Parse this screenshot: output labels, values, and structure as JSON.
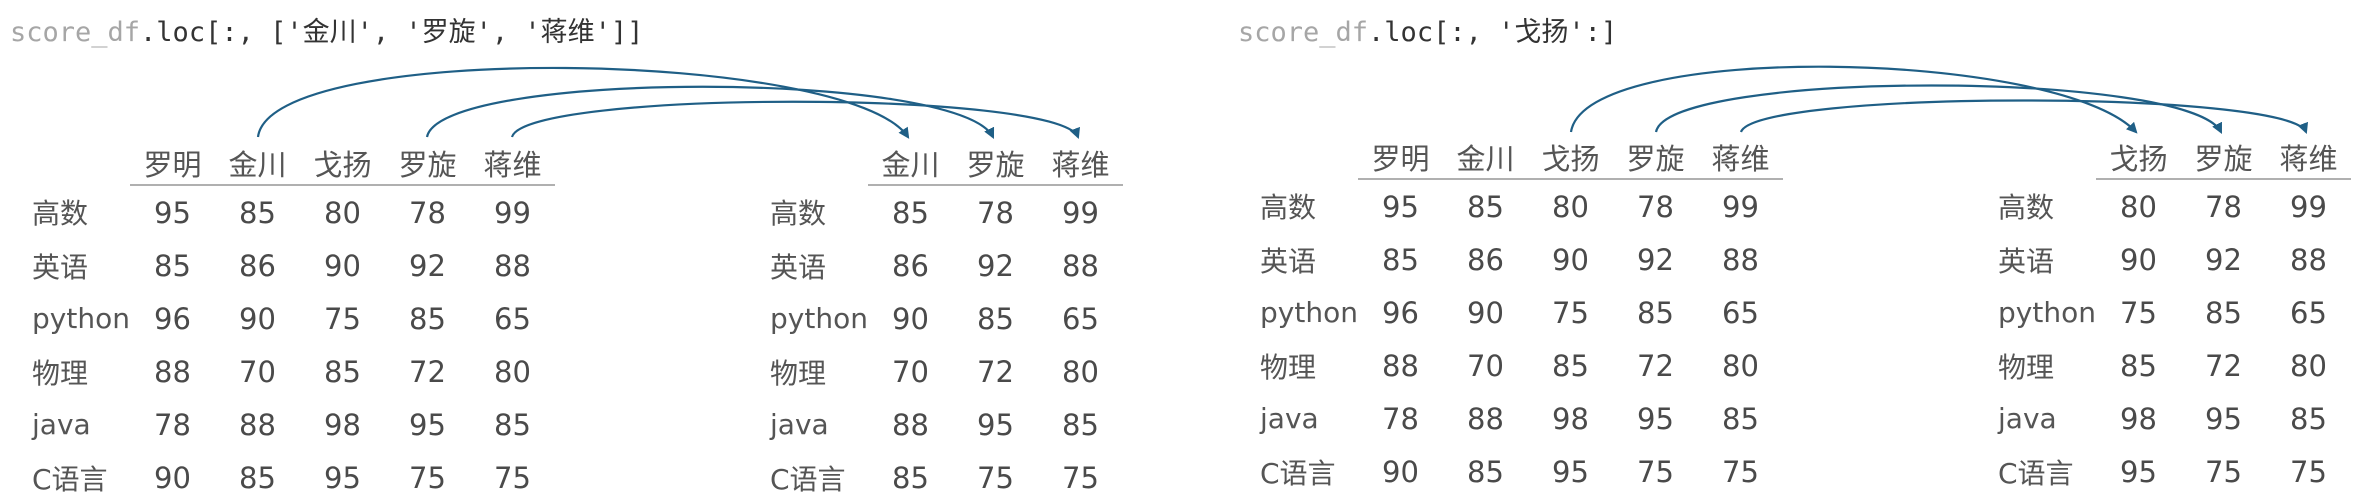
{
  "left": {
    "code": {
      "var": "score_df",
      "rest": ".loc[:, ['金川', '罗旋', '蒋维']]"
    },
    "source_table": {
      "columns": [
        "罗明",
        "金川",
        "戈扬",
        "罗旋",
        "蒋维"
      ],
      "rows": [
        {
          "label": "高数",
          "values": [
            "95",
            "85",
            "80",
            "78",
            "99"
          ]
        },
        {
          "label": "英语",
          "values": [
            "85",
            "86",
            "90",
            "92",
            "88"
          ]
        },
        {
          "label": "python",
          "values": [
            "96",
            "90",
            "75",
            "85",
            "65"
          ]
        },
        {
          "label": "物理",
          "values": [
            "88",
            "70",
            "85",
            "72",
            "80"
          ]
        },
        {
          "label": "java",
          "values": [
            "78",
            "88",
            "98",
            "95",
            "85"
          ]
        },
        {
          "label": "C语言",
          "values": [
            "90",
            "85",
            "95",
            "75",
            "75"
          ]
        }
      ]
    },
    "result_table": {
      "columns": [
        "金川",
        "罗旋",
        "蒋维"
      ],
      "rows": [
        {
          "label": "高数",
          "values": [
            "85",
            "78",
            "99"
          ]
        },
        {
          "label": "英语",
          "values": [
            "86",
            "92",
            "88"
          ]
        },
        {
          "label": "python",
          "values": [
            "90",
            "85",
            "65"
          ]
        },
        {
          "label": "物理",
          "values": [
            "70",
            "72",
            "80"
          ]
        },
        {
          "label": "java",
          "values": [
            "88",
            "95",
            "85"
          ]
        },
        {
          "label": "C语言",
          "values": [
            "85",
            "75",
            "75"
          ]
        }
      ]
    }
  },
  "right": {
    "code": {
      "var": "score_df",
      "rest": ".loc[:, '戈扬':]"
    },
    "source_table": {
      "columns": [
        "罗明",
        "金川",
        "戈扬",
        "罗旋",
        "蒋维"
      ],
      "rows": [
        {
          "label": "高数",
          "values": [
            "95",
            "85",
            "80",
            "78",
            "99"
          ]
        },
        {
          "label": "英语",
          "values": [
            "85",
            "86",
            "90",
            "92",
            "88"
          ]
        },
        {
          "label": "python",
          "values": [
            "96",
            "90",
            "75",
            "85",
            "65"
          ]
        },
        {
          "label": "物理",
          "values": [
            "88",
            "70",
            "85",
            "72",
            "80"
          ]
        },
        {
          "label": "java",
          "values": [
            "78",
            "88",
            "98",
            "95",
            "85"
          ]
        },
        {
          "label": "C语言",
          "values": [
            "90",
            "85",
            "95",
            "75",
            "75"
          ]
        }
      ]
    },
    "result_table": {
      "columns": [
        "戈扬",
        "罗旋",
        "蒋维"
      ],
      "rows": [
        {
          "label": "高数",
          "values": [
            "80",
            "78",
            "99"
          ]
        },
        {
          "label": "英语",
          "values": [
            "90",
            "92",
            "88"
          ]
        },
        {
          "label": "python",
          "values": [
            "75",
            "85",
            "65"
          ]
        },
        {
          "label": "物理",
          "values": [
            "85",
            "72",
            "80"
          ]
        },
        {
          "label": "java",
          "values": [
            "98",
            "95",
            "85"
          ]
        },
        {
          "label": "C语言",
          "values": [
            "95",
            "75",
            "75"
          ]
        }
      ]
    }
  },
  "colors": {
    "arrow": "#1f5f86"
  }
}
